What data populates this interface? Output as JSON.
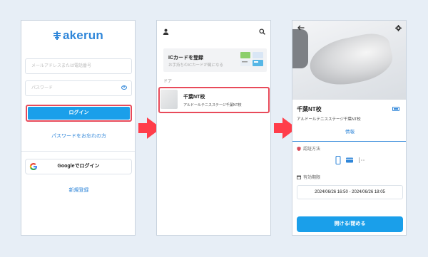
{
  "login": {
    "brand": "akerun",
    "email_placeholder": "メールアドレスまたは電話番号",
    "password_placeholder": "パスワード",
    "login_label": "ログイン",
    "forgot_label": "パスワードをお忘れの方",
    "google_label": "Googleでログイン",
    "register_label": "新規登録"
  },
  "home": {
    "ic_title": "ICカードを登録",
    "ic_subtitle": "お手持ちのICカードが鍵になる",
    "door_section": "ドア",
    "door": {
      "name": "千葉NT校",
      "subtitle": "アルドールテニスステージ千葉NT校"
    }
  },
  "detail": {
    "name": "千葉NT校",
    "subtitle": "アルドールテニスステージ千葉NT校",
    "tab_label": "情報",
    "auth_label": "認証方法",
    "validity_label": "有効期限",
    "validity_value": "2024/06/26 16:50 - 2024/06/26 18:05",
    "open_label": "開ける/閉める"
  },
  "colors": {
    "accent": "#1a9fea",
    "highlight": "#e84a5a",
    "arrow": "#ff3d4a",
    "brand": "#2f86d9"
  },
  "icons": [
    "eye-icon",
    "google-icon",
    "person-icon",
    "search-icon",
    "cards-icon",
    "back-icon",
    "gear-icon",
    "battery-icon",
    "shield-icon",
    "phone-icon",
    "card-icon",
    "nfc-icon",
    "calendar-icon"
  ]
}
